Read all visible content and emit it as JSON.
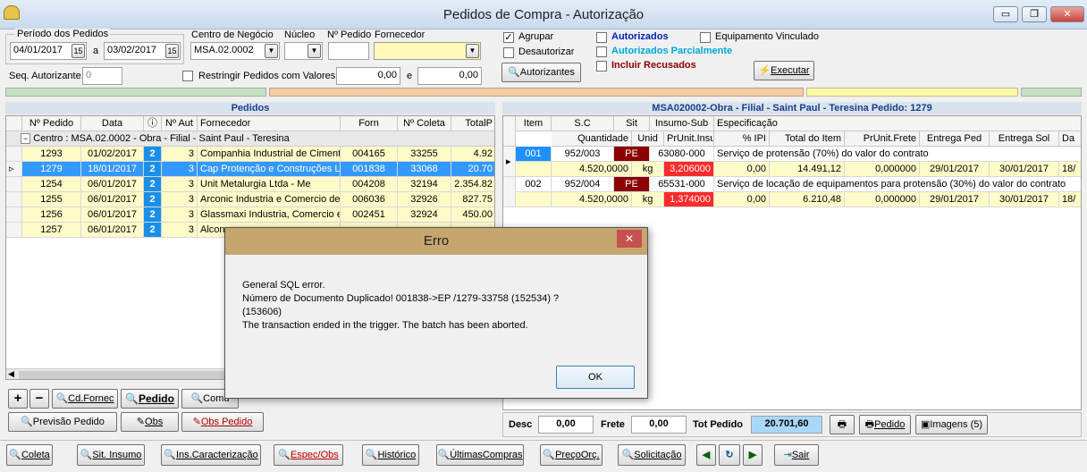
{
  "window": {
    "title": "Pedidos de Compra - Autorização",
    "min": "▭",
    "max": "❐",
    "close": "✕"
  },
  "filters": {
    "periodo_label": "Período dos Pedidos",
    "date_from": "04/01/2017",
    "a_label": "a",
    "date_to": "03/02/2017",
    "cal_icon": "15",
    "centro_label": "Centro de Negócio",
    "centro_value": "MSA.02.0002",
    "nucleo_label": "Núcleo",
    "npedido_label": "Nº Pedido",
    "fornecedor_label": "Fornecedor",
    "seq_label": "Seq. Autorizante:",
    "seq_value": "0",
    "restringir_label": "Restringir Pedidos com Valores",
    "val_from": "0,00",
    "e_label": "e",
    "val_to": "0,00",
    "agrupar": "Agrupar",
    "desautorizar": "Desautorizar",
    "autorizantes_btn": "Autorizantes",
    "autorizados": "Autorizados",
    "autorizados_parcialmente": "Autorizados Parcialmente",
    "incluir_recusados": "Incluir Recusados",
    "equip_vinculado": "Equipamento Vinculado",
    "executar_btn": "Executar"
  },
  "pedidos": {
    "header": "Pedidos",
    "cols": [
      "Nº Pedido",
      "Data",
      "",
      "Nº Aut",
      "Fornecedor",
      "Forn",
      "Nº Coleta",
      "TotalP"
    ],
    "group": "Centro : MSA.02.0002 - Obra - Filial - Saint Paul - Teresina",
    "rows": [
      [
        "1293",
        "01/02/2017",
        "2",
        "3",
        "Companhia Industrial de Cimento",
        "004165",
        "33255",
        "4.92"
      ],
      [
        "1279",
        "18/01/2017",
        "2",
        "3",
        "Cap Protenção e Construções Lt",
        "001838",
        "33068",
        "20.70"
      ],
      [
        "1254",
        "06/01/2017",
        "2",
        "3",
        "Unit Metalurgia Ltda - Me",
        "004208",
        "32194",
        "2.354.82"
      ],
      [
        "1255",
        "06/01/2017",
        "2",
        "3",
        "Arconic Industria e Comercio de",
        "006036",
        "32926",
        "827.75"
      ],
      [
        "1256",
        "06/01/2017",
        "2",
        "3",
        "Glassmaxi Industria, Comercio e S",
        "002451",
        "32924",
        "450.00"
      ],
      [
        "1257",
        "06/01/2017",
        "2",
        "3",
        "Alcon",
        "",
        "",
        ""
      ]
    ],
    "btn_plus": "+",
    "btn_minus": "−",
    "btn_cdfornec": "Cd.Fornec",
    "btn_pedido": "Pedido",
    "btn_comun": "Comu",
    "btn_previsao": "Previsão Pedido",
    "btn_obs": "Obs",
    "btn_obs_pedido": "Obs Pedido"
  },
  "itens": {
    "header": "MSA020002-Obra - Filial - Saint Paul - Teresina   Pedido: 1279",
    "cols1": [
      "Item",
      "S.C",
      "Sit",
      "Insumo-Sub",
      "Especificação"
    ],
    "cols2": [
      "Quantidade",
      "Unid",
      "PrUnit.Insumo",
      "% IPI",
      "Total do Item",
      "PrUnit.Frete",
      "Entrega Ped",
      "Entrega Sol",
      "Da"
    ],
    "rows": [
      {
        "item": "001",
        "sc": "952/003",
        "sit": "PE",
        "insumo": "63080-000",
        "espec": "Serviço de protensão  (70%) do valor do contrato",
        "qtd": "4.520,0000",
        "unid": "kg",
        "prunit": "3,206000",
        "ipi": "0,00",
        "total": "14.491,12",
        "frete": "0,000000",
        "entped": "29/01/2017",
        "entsol": "30/01/2017",
        "da": "18/"
      },
      {
        "item": "002",
        "sc": "952/004",
        "sit": "PE",
        "insumo": "65531-000",
        "espec": "Serviço de locação de equipamentos para protensão  (30%) do valor do contrato",
        "qtd": "4.520,0000",
        "unid": "kg",
        "prunit": "1,374000",
        "ipi": "0,00",
        "total": "6.210,48",
        "frete": "0,000000",
        "entped": "29/01/2017",
        "entsol": "30/01/2017",
        "da": "18/"
      }
    ],
    "desc_label": "Desc",
    "desc_value": "0,00",
    "frete_label": "Frete",
    "frete_value": "0,00",
    "tot_label": "Tot Pedido",
    "tot_value": "20.701,60",
    "btn_pedido": "Pedido",
    "btn_imagens": "Imagens (5)"
  },
  "dialog": {
    "title": "Erro",
    "close": "✕",
    "line1": "General SQL error.",
    "line2": "Número de Documento Duplicado! 001838->EP   /1279-33758         (152534)  ?",
    "line3": "(153606)",
    "line4": "The transaction ended in the trigger. The batch has been aborted.",
    "ok": "OK"
  },
  "bottom": {
    "coleta": "Coleta",
    "sit_insumo": "Sit. Insumo",
    "ins_caract": "Ins.Caracterização",
    "espec_obs": "Espec/Obs",
    "historico": "Histórico",
    "ultimas": "ÚltimasCompras",
    "preco": "PreçoOrç.",
    "solicitacao": "Solicitação",
    "sair": "Sair"
  },
  "colors": {
    "accent_blue": "#1e90ff",
    "status_red": "#8b0000",
    "highlight_red": "#ff2a2a",
    "row_yellow": "#fffbc9",
    "dialog_title": "#c5a66f"
  }
}
